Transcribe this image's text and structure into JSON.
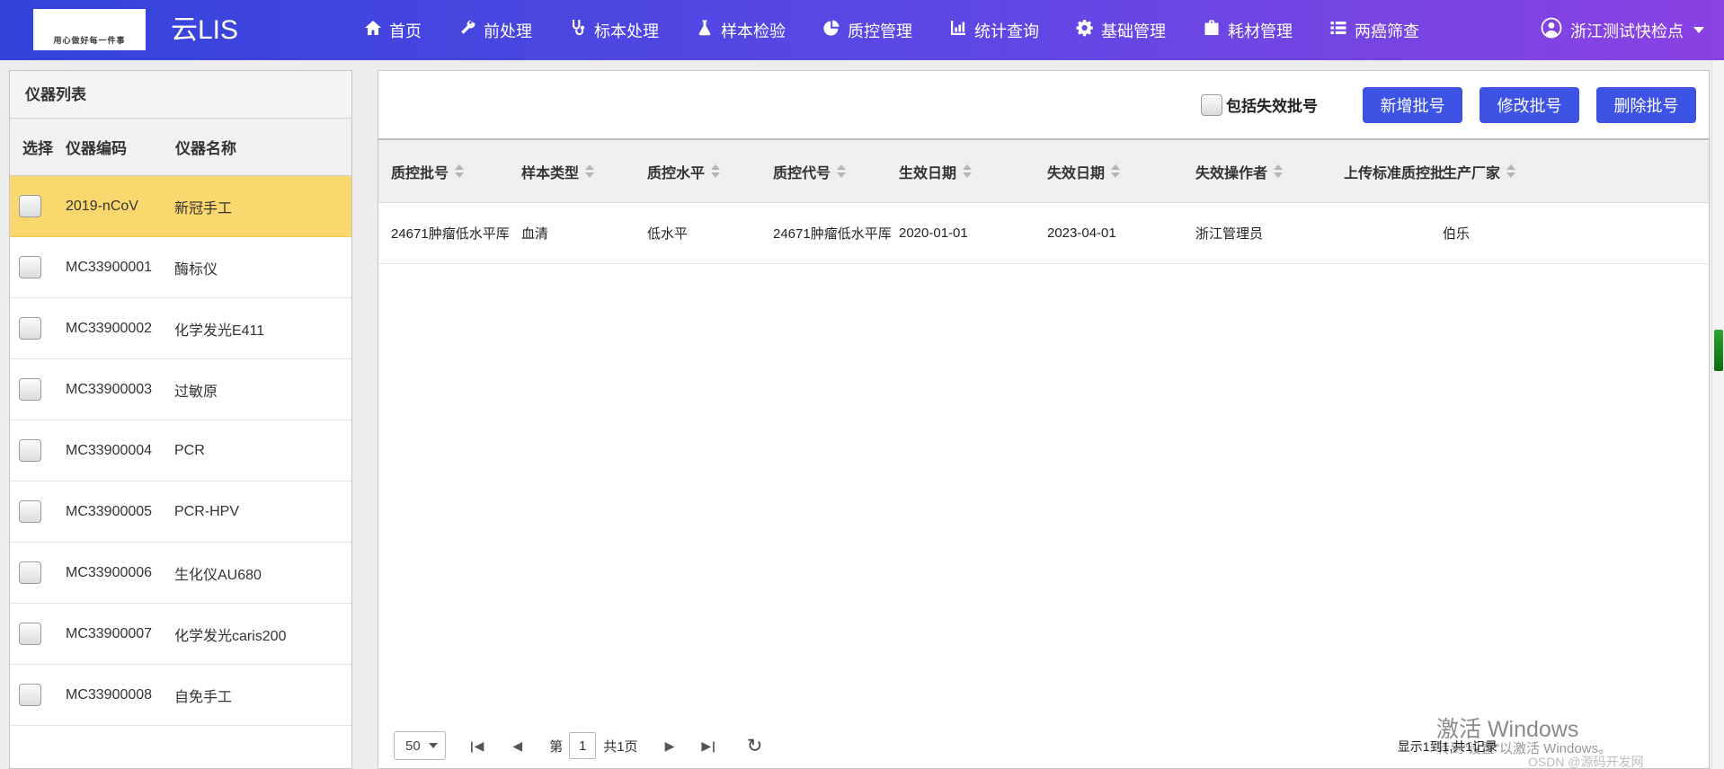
{
  "navbar": {
    "logo_tagline": "用心做好每一件事",
    "brand": "云LIS",
    "items": [
      {
        "label": "首页",
        "icon": "home-icon"
      },
      {
        "label": "前处理",
        "icon": "wrench-icon"
      },
      {
        "label": "标本处理",
        "icon": "stethoscope-icon"
      },
      {
        "label": "样本检验",
        "icon": "flask-icon"
      },
      {
        "label": "质控管理",
        "icon": "pie-chart-icon"
      },
      {
        "label": "统计查询",
        "icon": "bar-chart-icon"
      },
      {
        "label": "基础管理",
        "icon": "gear-icon"
      },
      {
        "label": "耗材管理",
        "icon": "briefcase-icon"
      },
      {
        "label": "两癌筛查",
        "icon": "list-icon"
      }
    ],
    "user": {
      "label": "浙江测试快检点",
      "icon": "user-icon",
      "caret_icon": "chevron-down-icon"
    }
  },
  "sidebar": {
    "title": "仪器列表",
    "columns": [
      "选择",
      "仪器编码",
      "仪器名称"
    ],
    "rows": [
      {
        "code": "2019-nCoV",
        "name": "新冠手工",
        "selected": true
      },
      {
        "code": "MC33900001",
        "name": "酶标仪",
        "selected": false
      },
      {
        "code": "MC33900002",
        "name": "化学发光E411",
        "selected": false
      },
      {
        "code": "MC33900003",
        "name": "过敏原",
        "selected": false
      },
      {
        "code": "MC33900004",
        "name": "PCR",
        "selected": false
      },
      {
        "code": "MC33900005",
        "name": "PCR-HPV",
        "selected": false
      },
      {
        "code": "MC33900006",
        "name": "生化仪AU680",
        "selected": false
      },
      {
        "code": "MC33900007",
        "name": "化学发光caris200",
        "selected": false
      },
      {
        "code": "MC33900008",
        "name": "自免手工",
        "selected": false
      }
    ]
  },
  "main": {
    "toolbar": {
      "include_expired_label": "包括失效批号",
      "buttons": [
        {
          "label": "新增批号"
        },
        {
          "label": "修改批号"
        },
        {
          "label": "删除批号"
        }
      ],
      "button_color": "#3c53e4"
    },
    "table": {
      "columns": [
        "质控批号",
        "样本类型",
        "质控水平",
        "质控代号",
        "生效日期",
        "失效日期",
        "失效操作者",
        "上传标准质控批",
        "生产厂家"
      ],
      "rows": [
        {
          "qc_batch": "24671肿瘤低水平厍",
          "sample_type": "血清",
          "qc_level": "低水平",
          "qc_code": "24671肿瘤低水平厍",
          "effective_date": "2020-01-01",
          "expire_date": "2023-04-01",
          "expire_operator": "浙江管理员",
          "upload_standard": "",
          "manufacturer": "伯乐"
        }
      ]
    },
    "pagination": {
      "page_size": "50",
      "page_prefix": "第",
      "current_page": "1",
      "total_pages": "共1页",
      "record_info": "显示1到1,共1记录"
    }
  },
  "watermarks": {
    "activate_title": "激活 Windows",
    "activate_subtitle": "转到“设置”以激活 Windows。",
    "osdn": "OSDN @源码开发网"
  },
  "colors": {
    "navbar_gradient_start": "#3243da",
    "navbar_gradient_end": "#8a42e2",
    "button_blue": "#3c53e4",
    "selected_row_yellow": "#fbd86e",
    "scrollbar_thumb_green": "#1f8f24"
  }
}
